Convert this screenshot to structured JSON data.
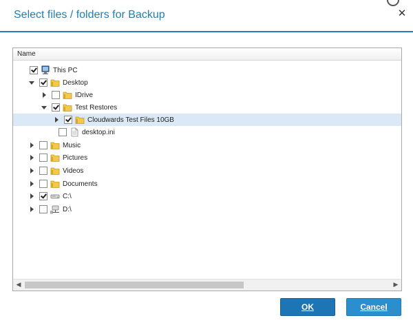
{
  "dialog": {
    "title": "Select files / folders for Backup",
    "close_glyph": "✕"
  },
  "tree": {
    "column_header": "Name",
    "rows": [
      {
        "label": "This PC",
        "icon": "computer-icon",
        "checked": true,
        "expander": "none",
        "selected": false
      },
      {
        "label": "Desktop",
        "icon": "folder-icon",
        "checked": true,
        "expander": "expanded",
        "selected": false
      },
      {
        "label": "IDrive",
        "icon": "folder-icon",
        "checked": false,
        "expander": "collapsed",
        "selected": false
      },
      {
        "label": "Test Restores",
        "icon": "folder-icon",
        "checked": true,
        "expander": "expanded",
        "selected": false
      },
      {
        "label": "Cloudwards Test Files 10GB",
        "icon": "folder-icon",
        "checked": true,
        "expander": "collapsed",
        "selected": true
      },
      {
        "label": "desktop.ini",
        "icon": "file-icon",
        "checked": false,
        "expander": "none",
        "selected": false
      },
      {
        "label": "Music",
        "icon": "folder-icon",
        "checked": false,
        "expander": "collapsed",
        "selected": false
      },
      {
        "label": "Pictures",
        "icon": "folder-icon",
        "checked": false,
        "expander": "collapsed",
        "selected": false
      },
      {
        "label": "Videos",
        "icon": "folder-icon",
        "checked": false,
        "expander": "collapsed",
        "selected": false
      },
      {
        "label": "Documents",
        "icon": "folder-icon",
        "checked": false,
        "expander": "collapsed",
        "selected": false
      },
      {
        "label": "C:\\",
        "icon": "drive-icon",
        "checked": true,
        "expander": "collapsed",
        "selected": false
      },
      {
        "label": "D:\\",
        "icon": "network-drive-icon",
        "checked": false,
        "expander": "collapsed",
        "selected": false
      }
    ],
    "scroll_left_glyph": "◀",
    "scroll_right_glyph": "▶"
  },
  "buttons": {
    "ok_label": "OK",
    "cancel_label": "Cancel"
  },
  "colors": {
    "accent": "#1f7fb4",
    "ok_button": "#1e75b3",
    "cancel_button": "#2b8fce",
    "selected_row": "#dbe9f6"
  }
}
